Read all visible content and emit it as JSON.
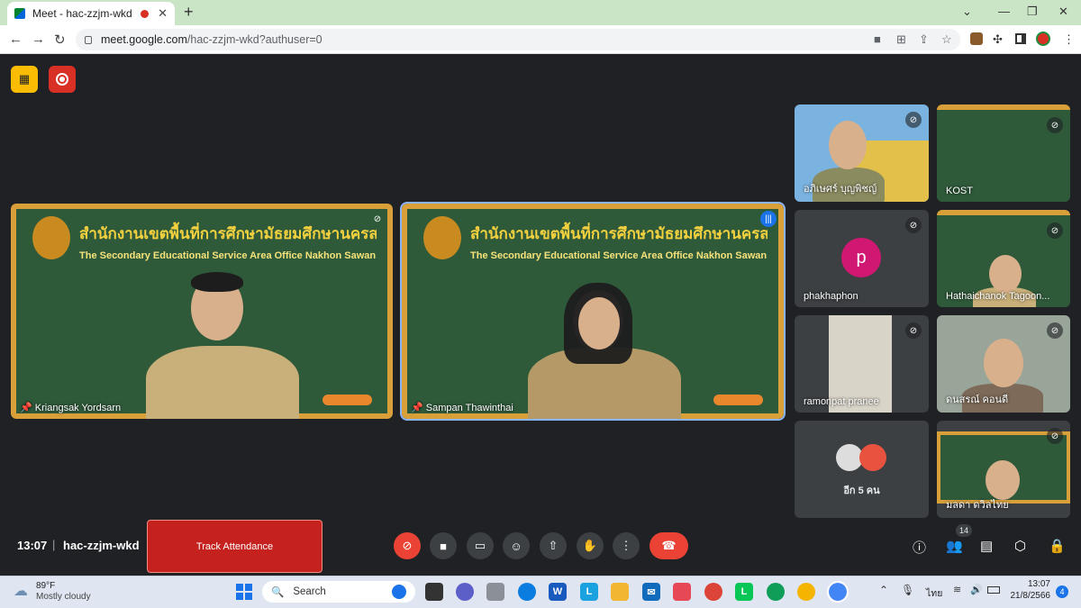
{
  "browser": {
    "tab_title": "Meet - hac-zzjm-wkd",
    "tab_close": "✕",
    "new_tab": "+",
    "url_host": "meet.google.com",
    "url_path": "/hac-zzjm-wkd?authuser=0"
  },
  "meeting": {
    "time": "13:07",
    "separator": "|",
    "code": "hac-zzjm-wkd",
    "track_attendance": "Track Attendance",
    "people_count": "14"
  },
  "main_tiles": [
    {
      "name": "Kriangsak Yordsarn",
      "board_th": "สำนักงานเขตพื้นที่การศึกษามัธยมศึกษานครสวรรค์",
      "board_en": "The Secondary Educational Service Area Office Nakhon Sawan"
    },
    {
      "name": "Sampan Thawinthai",
      "board_th": "สำนักงานเขตพื้นที่การศึกษามัธยมศึกษานครสวรรค์",
      "board_en": "The Secondary Educational Service Area Office Nakhon Sawan"
    }
  ],
  "side_tiles": [
    {
      "name": "อภิเษศร์ บุญพิชญ์"
    },
    {
      "name": "KOST"
    },
    {
      "name": "phakhaphon",
      "avatar_letter": "p"
    },
    {
      "name": "Hathaichanok Tagoon..."
    },
    {
      "name": "ramonpat pranee"
    },
    {
      "name": "ดนสรณ์ คอนดี"
    },
    {
      "name": "อีก 5 คน"
    },
    {
      "name": "มลดา ดวิลไทย"
    }
  ],
  "taskbar": {
    "weather_temp": "89°F",
    "weather_desc": "Mostly cloudy",
    "search": "Search",
    "lang": "ไทย",
    "clock_time": "13:07",
    "clock_date": "21/8/2566",
    "notif_count": "4"
  },
  "colors": {
    "accent_blue": "#8ab4f8",
    "end_call": "#ea4335",
    "mic_off": "#ea4335",
    "track_btn": "#c5221f",
    "chalk_green": "#2f5a3a",
    "board_frame": "#d9a03a"
  }
}
